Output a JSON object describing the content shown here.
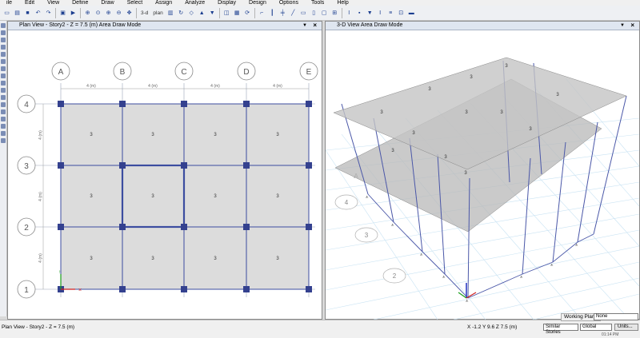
{
  "menu": [
    "ile",
    "Edit",
    "View",
    "Define",
    "Draw",
    "Select",
    "Assign",
    "Analyze",
    "Display",
    "Design",
    "Options",
    "Tools",
    "Help"
  ],
  "toolbar": {
    "view_3d": "3-d",
    "plan_label": "plan"
  },
  "plan_view": {
    "title": "Plan View - Story2 - Z = 7.5 (m)  Area Draw Mode",
    "grid_cols": [
      "A",
      "B",
      "C",
      "D",
      "E"
    ],
    "grid_rows": [
      "4",
      "3",
      "2",
      "1"
    ],
    "col_spacing": "4 (m)",
    "row_spacing": "4 (m)",
    "area_label": "3"
  },
  "view3d": {
    "title": "3-D View  Area Draw Mode",
    "labels": [
      "A",
      "4",
      "3",
      "2"
    ],
    "area_label": "3"
  },
  "status": {
    "left": "Plan View - Story2 - Z = 7.5 (m)",
    "coords": "X -1.2  Y 9.6  Z 7.5 (m)",
    "working_plane_label": "Working Plane",
    "working_plane_value": "None",
    "stories_value": "Similar Stories",
    "coord_system": "Global",
    "units_button": "Units...",
    "clock": "01:14 PM"
  }
}
